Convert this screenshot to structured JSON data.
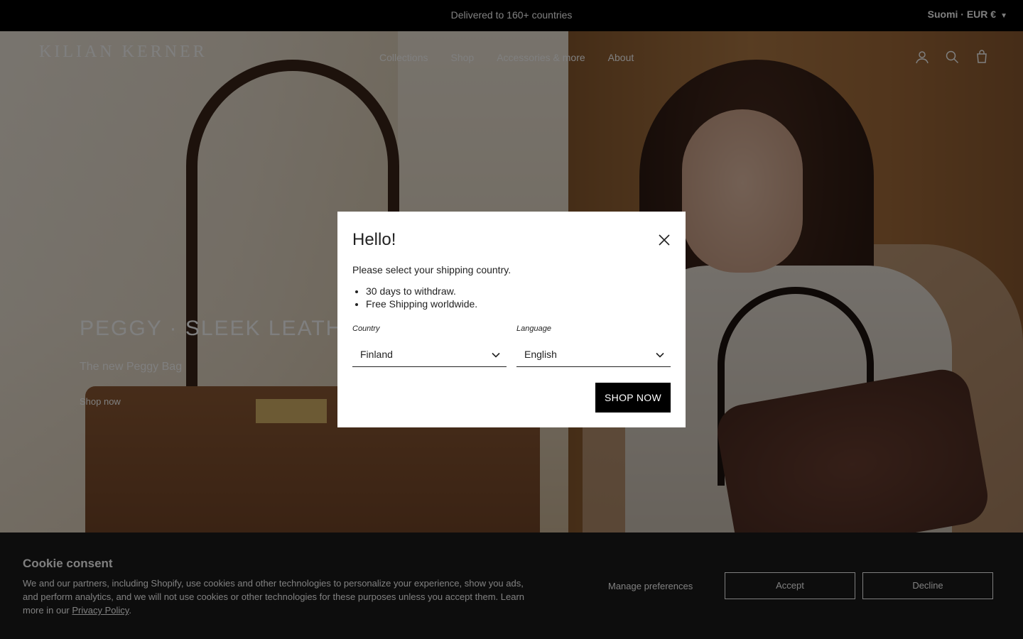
{
  "announcement": {
    "text": "Delivered to 160+ countries",
    "currency": "Suomi · EUR €"
  },
  "header": {
    "logo": "KILIAN KERNER",
    "nav": [
      "Collections",
      "Shop",
      "Accessories & more",
      "About"
    ],
    "icons": [
      "account-icon",
      "search-icon",
      "cart-icon"
    ]
  },
  "hero": {
    "title": "PEGGY · SLEEK LEATHER BAG",
    "subtitle": "The new Peggy Bag",
    "link": "Shop now"
  },
  "modal": {
    "title": "Hello!",
    "description": "Please select your shipping country.",
    "bullets": [
      "30 days to withdraw.",
      "Free Shipping worldwide."
    ],
    "country_label": "Country",
    "country_value": "Finland",
    "language_label": "Language",
    "language_value": "English",
    "cta": "SHOP NOW"
  },
  "cookie": {
    "title": "Cookie consent",
    "body": "We and our partners, including Shopify, use cookies and other technologies to personalize your experience, show you ads, and perform analytics, and we will not use cookies or other technologies for these purposes unless you accept them. Learn more in our",
    "privacy_link": "Privacy Policy",
    "manage": "Manage preferences",
    "accept": "Accept",
    "decline": "Decline"
  }
}
